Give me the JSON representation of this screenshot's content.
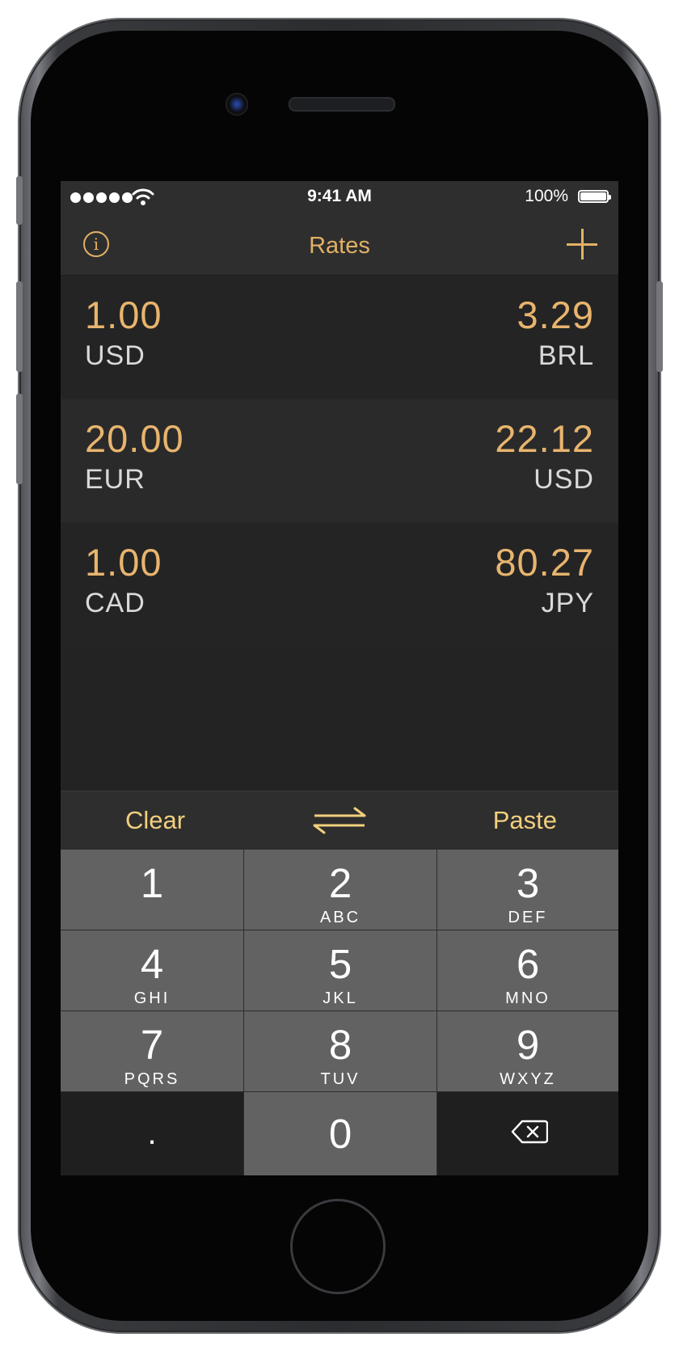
{
  "status_bar": {
    "time": "9:41 AM",
    "battery": "100%"
  },
  "nav": {
    "title": "Rates",
    "info_icon": "info-circle-icon",
    "add_icon": "plus-icon"
  },
  "rates": [
    {
      "from_amount": "1.00",
      "from_code": "USD",
      "to_amount": "3.29",
      "to_code": "BRL"
    },
    {
      "from_amount": "20.00",
      "from_code": "EUR",
      "to_amount": "22.12",
      "to_code": "USD"
    },
    {
      "from_amount": "1.00",
      "from_code": "CAD",
      "to_amount": "80.27",
      "to_code": "JPY"
    }
  ],
  "toolbar": {
    "clear": "Clear",
    "swap_icon": "swap-arrows-icon",
    "paste": "Paste"
  },
  "keypad": {
    "keys": [
      {
        "num": "1",
        "letters": ""
      },
      {
        "num": "2",
        "letters": "ABC"
      },
      {
        "num": "3",
        "letters": "DEF"
      },
      {
        "num": "4",
        "letters": "GHI"
      },
      {
        "num": "5",
        "letters": "JKL"
      },
      {
        "num": "6",
        "letters": "MNO"
      },
      {
        "num": "7",
        "letters": "PQRS"
      },
      {
        "num": "8",
        "letters": "TUV"
      },
      {
        "num": "9",
        "letters": "WXYZ"
      },
      {
        "num": ".",
        "letters": ""
      },
      {
        "num": "0",
        "letters": ""
      }
    ],
    "delete_icon": "backspace-icon"
  },
  "colors": {
    "accent": "#e2b164",
    "amount": "#e8b46e",
    "background": "#232323",
    "key": "#626262"
  }
}
